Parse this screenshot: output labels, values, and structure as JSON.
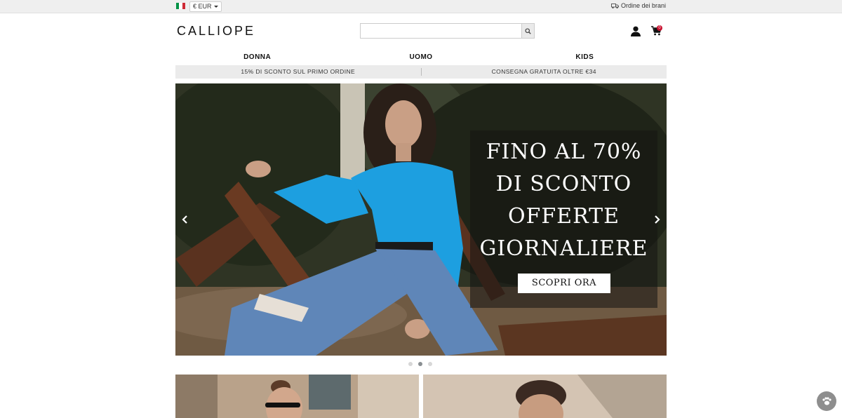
{
  "topbar": {
    "flag": [
      "#009246",
      "#ffffff",
      "#ce2b37"
    ],
    "currency": "€ EUR",
    "order_tracking": "Ordine dei brani"
  },
  "header": {
    "logo": "CALLIOPE",
    "search_placeholder": "",
    "cart_count": "0"
  },
  "nav": [
    {
      "label": "DONNA"
    },
    {
      "label": "UOMO"
    },
    {
      "label": "KIDS"
    }
  ],
  "promo": {
    "left": "15% DI SCONTO SUL PRIMO ORDINE",
    "right": "CONSEGNA GRATUITA OLTRE €34"
  },
  "hero": {
    "lines": [
      "FINO AL 70%",
      "DI SCONTO",
      "OFFERTE",
      "GIORNALIERE"
    ],
    "cta": "SCOPRI ORA",
    "active_slide": 2,
    "slide_count": 3
  },
  "colors": {
    "badge": "#c8102e",
    "promo_bg": "#ebebeb",
    "shirt": "#1d9fe0",
    "jeans": "#5f86b8"
  }
}
